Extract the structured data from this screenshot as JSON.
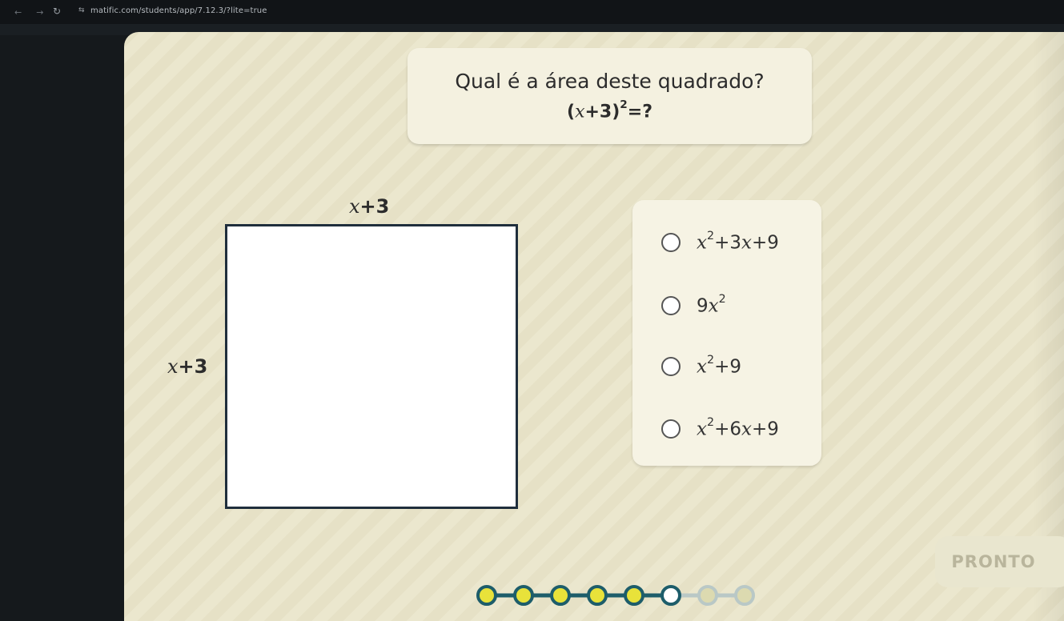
{
  "browser": {
    "url": "matific.com/students/app/7.12.3/?lite=true"
  },
  "question": {
    "title": "Qual é a área deste quadrado?",
    "formula_open": "(",
    "formula_var": "x",
    "formula_rest": "+3)",
    "formula_exp": "2",
    "formula_end": "=?"
  },
  "diagram": {
    "top_label_var": "x",
    "top_label_rest": "+3",
    "left_label_var": "x",
    "left_label_rest": "+3"
  },
  "options": [
    {
      "p1": "x",
      "sup": "2",
      "p2": "+3",
      "p3": "x",
      "p4": "+9"
    },
    {
      "p1": "9",
      "p2": "x",
      "sup": "2"
    },
    {
      "p1": "x",
      "sup": "2",
      "p2": "+9"
    },
    {
      "p1": "x",
      "sup": "2",
      "p2": "+6",
      "p3": "x",
      "p4": "+9"
    }
  ],
  "button": {
    "label": "PRONTO"
  },
  "progress": {
    "completed_steps": 5,
    "current_step": 6,
    "total_steps": 8,
    "completed_color": "#e8e23a",
    "track_color": "#1d5d6a"
  },
  "colors": {
    "background": "#e6e1c6",
    "bookmark": "#e0484f"
  }
}
